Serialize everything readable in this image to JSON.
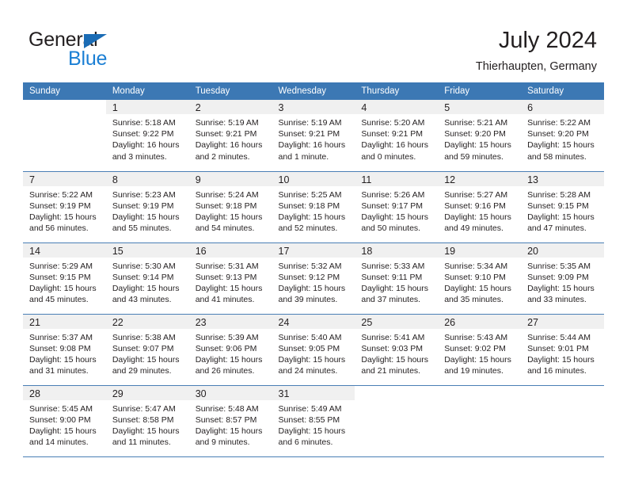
{
  "logo": {
    "word_top": "General",
    "word_bottom": "Blue",
    "triangle_color": "#1b6cb5",
    "blue_color": "#1b7fd4"
  },
  "header": {
    "title": "July 2024",
    "subtitle": "Thierhaupten, Germany"
  },
  "theme": {
    "header_bar": "#3c78b4",
    "daynum_band": "#f0f0f0",
    "row_divider": "#4a7fb5",
    "text": "#231f20"
  },
  "weekday_headers": [
    "Sunday",
    "Monday",
    "Tuesday",
    "Wednesday",
    "Thursday",
    "Friday",
    "Saturday"
  ],
  "weeks": [
    [
      {
        "day": "",
        "sunrise": "",
        "sunset": "",
        "daylight_line1": "",
        "daylight_line2": ""
      },
      {
        "day": "1",
        "sunrise": "Sunrise: 5:18 AM",
        "sunset": "Sunset: 9:22 PM",
        "daylight_line1": "Daylight: 16 hours",
        "daylight_line2": "and 3 minutes."
      },
      {
        "day": "2",
        "sunrise": "Sunrise: 5:19 AM",
        "sunset": "Sunset: 9:21 PM",
        "daylight_line1": "Daylight: 16 hours",
        "daylight_line2": "and 2 minutes."
      },
      {
        "day": "3",
        "sunrise": "Sunrise: 5:19 AM",
        "sunset": "Sunset: 9:21 PM",
        "daylight_line1": "Daylight: 16 hours",
        "daylight_line2": "and 1 minute."
      },
      {
        "day": "4",
        "sunrise": "Sunrise: 5:20 AM",
        "sunset": "Sunset: 9:21 PM",
        "daylight_line1": "Daylight: 16 hours",
        "daylight_line2": "and 0 minutes."
      },
      {
        "day": "5",
        "sunrise": "Sunrise: 5:21 AM",
        "sunset": "Sunset: 9:20 PM",
        "daylight_line1": "Daylight: 15 hours",
        "daylight_line2": "and 59 minutes."
      },
      {
        "day": "6",
        "sunrise": "Sunrise: 5:22 AM",
        "sunset": "Sunset: 9:20 PM",
        "daylight_line1": "Daylight: 15 hours",
        "daylight_line2": "and 58 minutes."
      }
    ],
    [
      {
        "day": "7",
        "sunrise": "Sunrise: 5:22 AM",
        "sunset": "Sunset: 9:19 PM",
        "daylight_line1": "Daylight: 15 hours",
        "daylight_line2": "and 56 minutes."
      },
      {
        "day": "8",
        "sunrise": "Sunrise: 5:23 AM",
        "sunset": "Sunset: 9:19 PM",
        "daylight_line1": "Daylight: 15 hours",
        "daylight_line2": "and 55 minutes."
      },
      {
        "day": "9",
        "sunrise": "Sunrise: 5:24 AM",
        "sunset": "Sunset: 9:18 PM",
        "daylight_line1": "Daylight: 15 hours",
        "daylight_line2": "and 54 minutes."
      },
      {
        "day": "10",
        "sunrise": "Sunrise: 5:25 AM",
        "sunset": "Sunset: 9:18 PM",
        "daylight_line1": "Daylight: 15 hours",
        "daylight_line2": "and 52 minutes."
      },
      {
        "day": "11",
        "sunrise": "Sunrise: 5:26 AM",
        "sunset": "Sunset: 9:17 PM",
        "daylight_line1": "Daylight: 15 hours",
        "daylight_line2": "and 50 minutes."
      },
      {
        "day": "12",
        "sunrise": "Sunrise: 5:27 AM",
        "sunset": "Sunset: 9:16 PM",
        "daylight_line1": "Daylight: 15 hours",
        "daylight_line2": "and 49 minutes."
      },
      {
        "day": "13",
        "sunrise": "Sunrise: 5:28 AM",
        "sunset": "Sunset: 9:15 PM",
        "daylight_line1": "Daylight: 15 hours",
        "daylight_line2": "and 47 minutes."
      }
    ],
    [
      {
        "day": "14",
        "sunrise": "Sunrise: 5:29 AM",
        "sunset": "Sunset: 9:15 PM",
        "daylight_line1": "Daylight: 15 hours",
        "daylight_line2": "and 45 minutes."
      },
      {
        "day": "15",
        "sunrise": "Sunrise: 5:30 AM",
        "sunset": "Sunset: 9:14 PM",
        "daylight_line1": "Daylight: 15 hours",
        "daylight_line2": "and 43 minutes."
      },
      {
        "day": "16",
        "sunrise": "Sunrise: 5:31 AM",
        "sunset": "Sunset: 9:13 PM",
        "daylight_line1": "Daylight: 15 hours",
        "daylight_line2": "and 41 minutes."
      },
      {
        "day": "17",
        "sunrise": "Sunrise: 5:32 AM",
        "sunset": "Sunset: 9:12 PM",
        "daylight_line1": "Daylight: 15 hours",
        "daylight_line2": "and 39 minutes."
      },
      {
        "day": "18",
        "sunrise": "Sunrise: 5:33 AM",
        "sunset": "Sunset: 9:11 PM",
        "daylight_line1": "Daylight: 15 hours",
        "daylight_line2": "and 37 minutes."
      },
      {
        "day": "19",
        "sunrise": "Sunrise: 5:34 AM",
        "sunset": "Sunset: 9:10 PM",
        "daylight_line1": "Daylight: 15 hours",
        "daylight_line2": "and 35 minutes."
      },
      {
        "day": "20",
        "sunrise": "Sunrise: 5:35 AM",
        "sunset": "Sunset: 9:09 PM",
        "daylight_line1": "Daylight: 15 hours",
        "daylight_line2": "and 33 minutes."
      }
    ],
    [
      {
        "day": "21",
        "sunrise": "Sunrise: 5:37 AM",
        "sunset": "Sunset: 9:08 PM",
        "daylight_line1": "Daylight: 15 hours",
        "daylight_line2": "and 31 minutes."
      },
      {
        "day": "22",
        "sunrise": "Sunrise: 5:38 AM",
        "sunset": "Sunset: 9:07 PM",
        "daylight_line1": "Daylight: 15 hours",
        "daylight_line2": "and 29 minutes."
      },
      {
        "day": "23",
        "sunrise": "Sunrise: 5:39 AM",
        "sunset": "Sunset: 9:06 PM",
        "daylight_line1": "Daylight: 15 hours",
        "daylight_line2": "and 26 minutes."
      },
      {
        "day": "24",
        "sunrise": "Sunrise: 5:40 AM",
        "sunset": "Sunset: 9:05 PM",
        "daylight_line1": "Daylight: 15 hours",
        "daylight_line2": "and 24 minutes."
      },
      {
        "day": "25",
        "sunrise": "Sunrise: 5:41 AM",
        "sunset": "Sunset: 9:03 PM",
        "daylight_line1": "Daylight: 15 hours",
        "daylight_line2": "and 21 minutes."
      },
      {
        "day": "26",
        "sunrise": "Sunrise: 5:43 AM",
        "sunset": "Sunset: 9:02 PM",
        "daylight_line1": "Daylight: 15 hours",
        "daylight_line2": "and 19 minutes."
      },
      {
        "day": "27",
        "sunrise": "Sunrise: 5:44 AM",
        "sunset": "Sunset: 9:01 PM",
        "daylight_line1": "Daylight: 15 hours",
        "daylight_line2": "and 16 minutes."
      }
    ],
    [
      {
        "day": "28",
        "sunrise": "Sunrise: 5:45 AM",
        "sunset": "Sunset: 9:00 PM",
        "daylight_line1": "Daylight: 15 hours",
        "daylight_line2": "and 14 minutes."
      },
      {
        "day": "29",
        "sunrise": "Sunrise: 5:47 AM",
        "sunset": "Sunset: 8:58 PM",
        "daylight_line1": "Daylight: 15 hours",
        "daylight_line2": "and 11 minutes."
      },
      {
        "day": "30",
        "sunrise": "Sunrise: 5:48 AM",
        "sunset": "Sunset: 8:57 PM",
        "daylight_line1": "Daylight: 15 hours",
        "daylight_line2": "and 9 minutes."
      },
      {
        "day": "31",
        "sunrise": "Sunrise: 5:49 AM",
        "sunset": "Sunset: 8:55 PM",
        "daylight_line1": "Daylight: 15 hours",
        "daylight_line2": "and 6 minutes."
      },
      {
        "day": "",
        "sunrise": "",
        "sunset": "",
        "daylight_line1": "",
        "daylight_line2": ""
      },
      {
        "day": "",
        "sunrise": "",
        "sunset": "",
        "daylight_line1": "",
        "daylight_line2": ""
      },
      {
        "day": "",
        "sunrise": "",
        "sunset": "",
        "daylight_line1": "",
        "daylight_line2": ""
      }
    ]
  ]
}
